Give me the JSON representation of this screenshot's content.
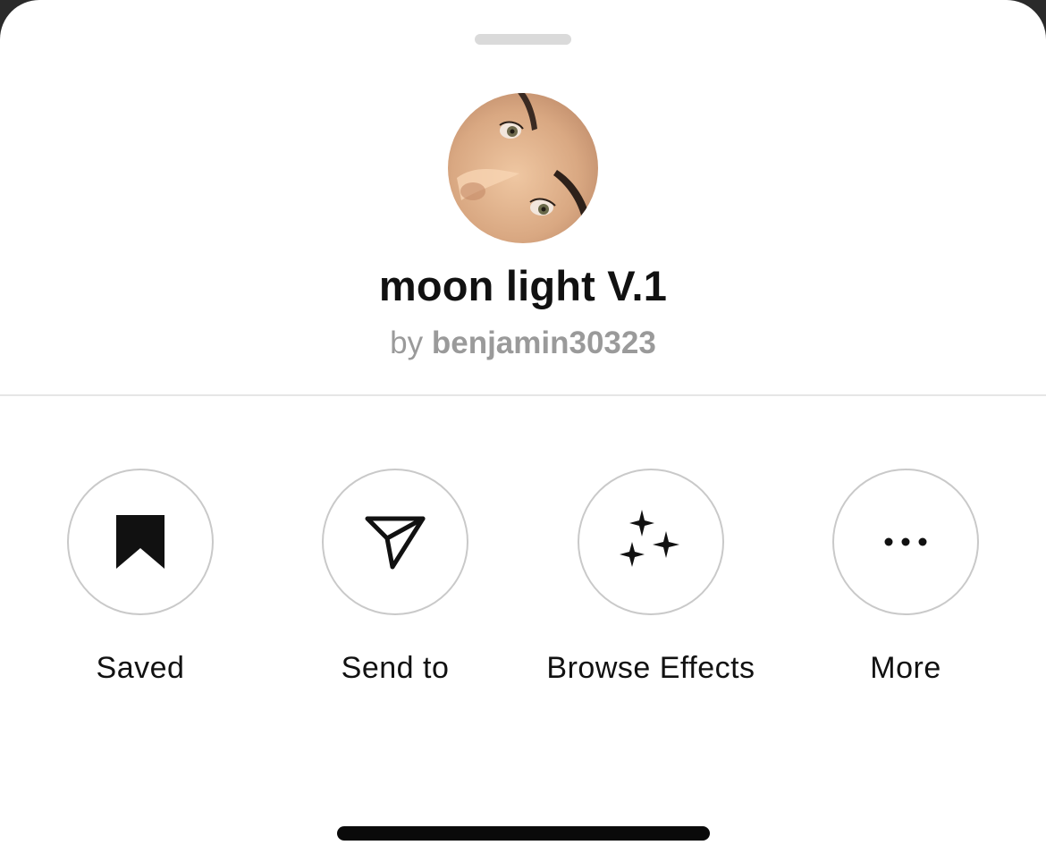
{
  "sheet": {
    "title": "moon light V.1",
    "by_prefix": "by",
    "creator": "benjamin30323"
  },
  "actions": [
    {
      "label": "Saved",
      "icon": "bookmark-filled-icon"
    },
    {
      "label": "Send to",
      "icon": "paper-plane-icon"
    },
    {
      "label": "Browse Effects",
      "icon": "sparkles-icon"
    },
    {
      "label": "More",
      "icon": "more-dots-icon"
    }
  ],
  "colors": {
    "background": "#ffffff",
    "title": "#111111",
    "byline": "#9a9a9a",
    "circle_border": "#c9c9c9",
    "divider": "#e6e6e6",
    "grabber": "#dadada"
  }
}
